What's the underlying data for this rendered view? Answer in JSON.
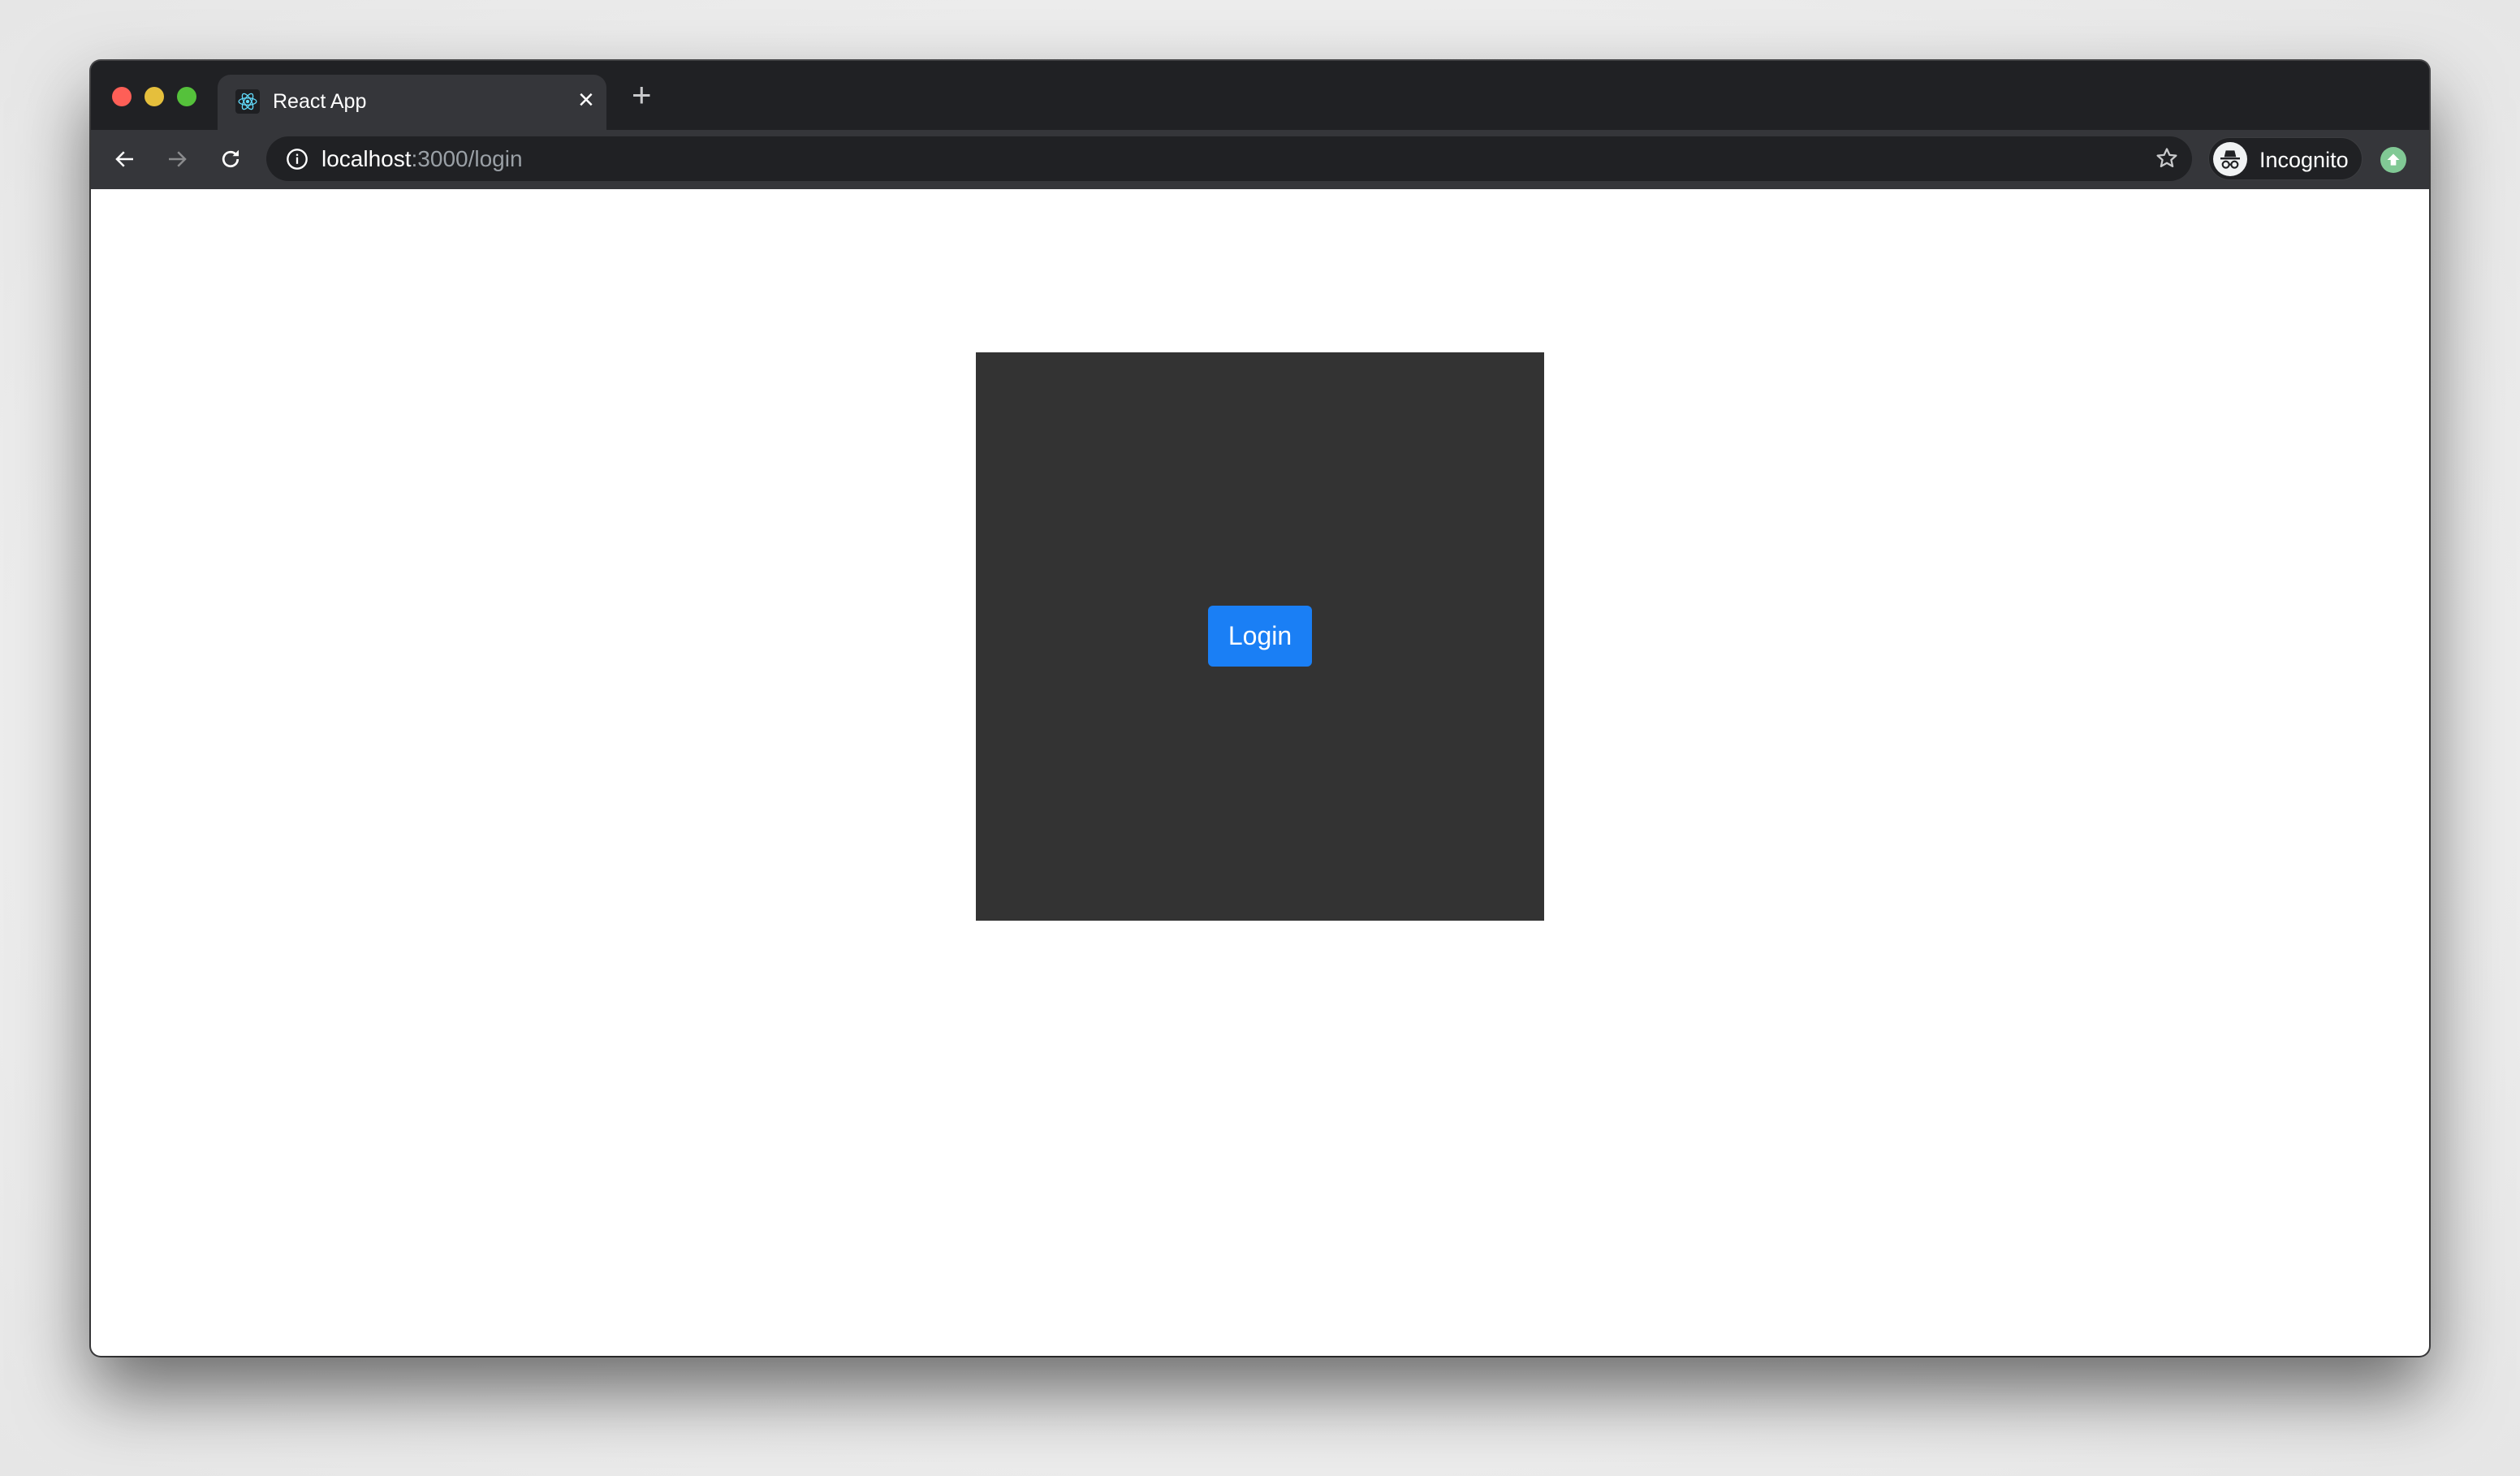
{
  "browser": {
    "window_controls": [
      "close",
      "minimize",
      "maximize"
    ],
    "tab": {
      "title": "React App",
      "favicon": "react-logo-icon",
      "close_label": "×"
    },
    "new_tab_label": "+",
    "nav": {
      "back": "back-arrow-icon",
      "forward": "forward-arrow-icon",
      "reload": "reload-icon"
    },
    "address_bar": {
      "host": "localhost",
      "path": ":3000/login",
      "security_icon": "info-icon"
    },
    "bookmark_icon": "star-icon",
    "profile": {
      "label": "Incognito",
      "icon": "incognito-icon"
    },
    "update_icon": "update-arrow-icon"
  },
  "page": {
    "login_button_label": "Login"
  },
  "colors": {
    "frame": "#202124",
    "toolbar": "#35363a",
    "panel": "#333333",
    "button": "#1a7ff5",
    "update_badge": "#81c995"
  }
}
